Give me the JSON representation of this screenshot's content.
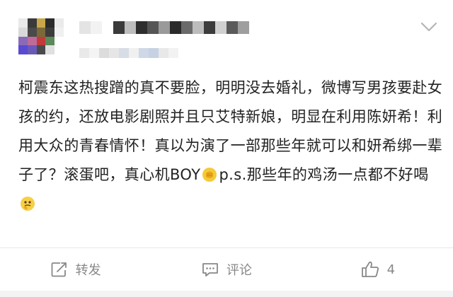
{
  "post": {
    "text_before_emoji": "柯震东这热搜蹭的真不要脸，明明没去婚礼，微博写男孩要赴女孩的约，还放电影剧照并且只艾特新娘，明显在利用陈妍希！利用大众的青春情怀！真以为演了一部那些年就可以和妍希绑一辈子了？滚蛋吧，真心机BOY",
    "text_after_emoji": "p.s.那些年的鸡汤一点都不好喝",
    "emoji_1": "punch-emoji",
    "emoji_2": "thinking-emoji"
  },
  "header": {
    "menu_icon": "chevron-down-icon"
  },
  "actions": {
    "repost_label": "转发",
    "comment_label": "评论",
    "like_count": "4"
  },
  "colors": {
    "text": "#222222",
    "action_gray": "#888888",
    "background": "#f3f3f3"
  }
}
